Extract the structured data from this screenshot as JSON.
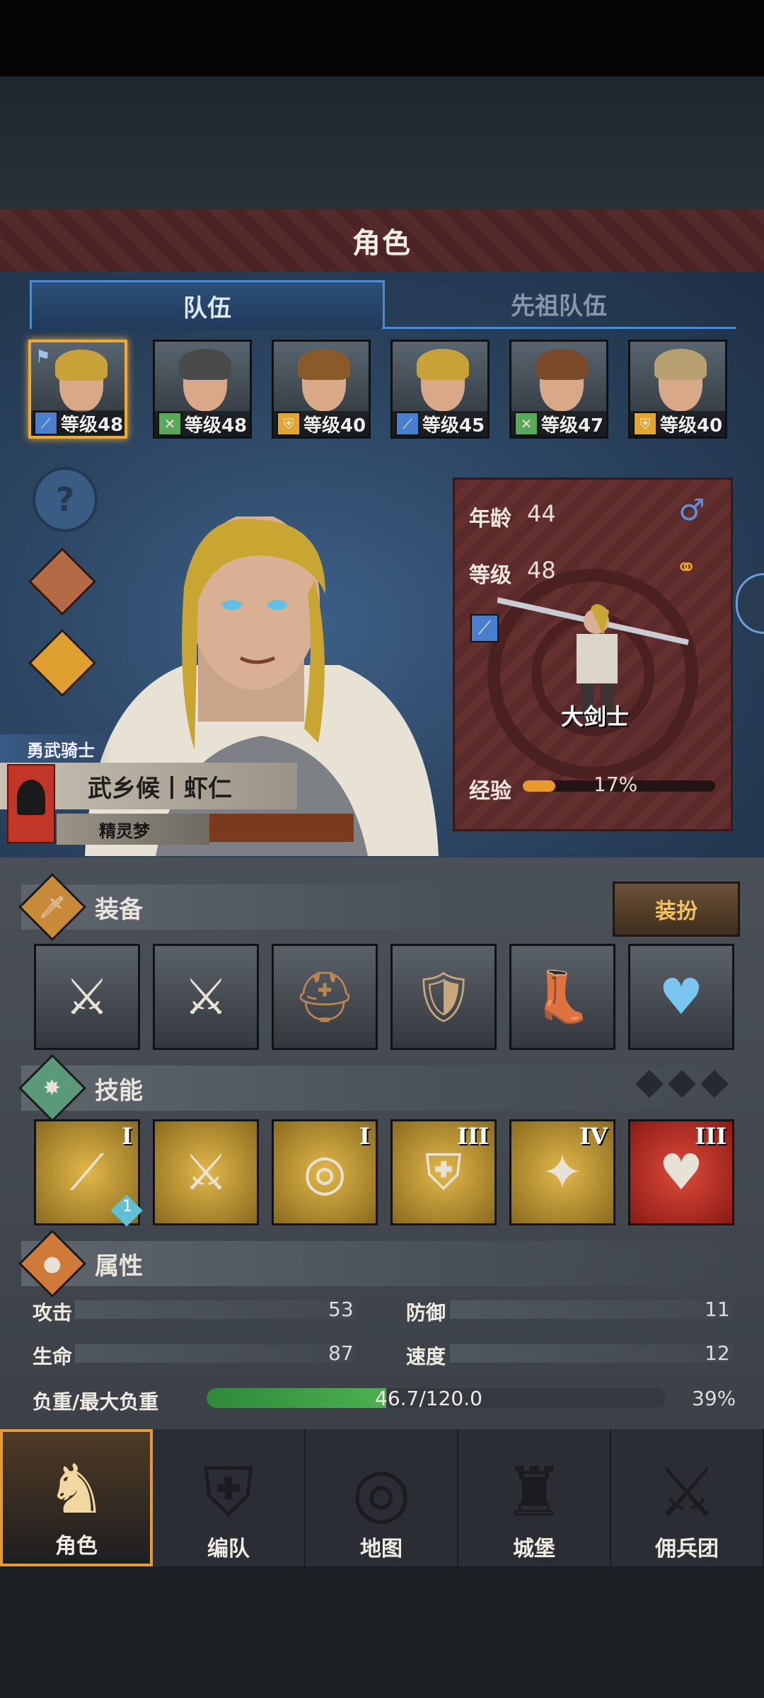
{
  "header": {
    "title": "角色"
  },
  "tabs": [
    {
      "label": "队伍",
      "active": true
    },
    {
      "label": "先祖队伍",
      "active": false
    }
  ],
  "party": [
    {
      "level": "等级48",
      "class_icon": "sword-icon",
      "class_color": "#4a7fd0",
      "hair": "#c8a238",
      "selected": true
    },
    {
      "level": "等级48",
      "class_icon": "crossed-swords-icon",
      "class_color": "#59a85a",
      "hair": "#4a4a4a",
      "selected": false
    },
    {
      "level": "等级40",
      "class_icon": "shield-icon",
      "class_color": "#e0a630",
      "hair": "#8a5a2a",
      "selected": false
    },
    {
      "level": "等级45",
      "class_icon": "sword-icon",
      "class_color": "#4a7fd0",
      "hair": "#c8a238",
      "selected": false
    },
    {
      "level": "等级47",
      "class_icon": "crossed-swords-icon",
      "class_color": "#59a85a",
      "hair": "#7a4a2a",
      "selected": false
    },
    {
      "level": "等级40",
      "class_icon": "shield-icon",
      "class_color": "#e0a630",
      "hair": "#b8a070",
      "selected": false
    }
  ],
  "side_icons": [
    "help-icon",
    "armor-figure-icon",
    "potion-bag-icon"
  ],
  "character": {
    "title": "勇武骑士",
    "name": "武乡候丨虾仁",
    "nickname": "精灵梦",
    "age_label": "年龄",
    "age": "44",
    "level_label": "等级",
    "level": "48",
    "class_name": "大剑士",
    "exp_label": "经验",
    "exp_percent": "17%",
    "exp_fraction": 0.17
  },
  "equipment": {
    "title": "装备",
    "outfit_button": "装扮",
    "slots": [
      "greatsword-icon",
      "greatsword-icon",
      "helmet-icon",
      "armor-icon",
      "boots-icon",
      "amulet-icon"
    ]
  },
  "skills": {
    "title": "技能",
    "items": [
      {
        "icon": "slash-skill-icon",
        "rank": "I",
        "bg": "#d4a93a"
      },
      {
        "icon": "sword-aura-skill-icon",
        "rank": "",
        "bg": "#d4a93a"
      },
      {
        "icon": "target-skill-icon",
        "rank": "I",
        "bg": "#d4a93a"
      },
      {
        "icon": "shield-skill-icon",
        "rank": "III",
        "bg": "#d4a93a"
      },
      {
        "icon": "shatter-skill-icon",
        "rank": "IV",
        "bg": "#d4a93a"
      },
      {
        "icon": "heartbeat-skill-icon",
        "rank": "III",
        "bg": "#c0302a"
      }
    ],
    "badge": "1"
  },
  "attributes": {
    "title": "属性",
    "attack_label": "攻击",
    "attack": "53",
    "defense_label": "防御",
    "defense": "11",
    "hp_label": "生命",
    "hp": "87",
    "speed_label": "速度",
    "speed": "12",
    "load_label": "负重/最大负重",
    "load": "46.7/120.0",
    "load_percent": "39%",
    "load_fraction": 0.39
  },
  "nav": [
    {
      "label": "角色",
      "icon": "knight-icon",
      "active": true
    },
    {
      "label": "编队",
      "icon": "formation-icon",
      "active": false
    },
    {
      "label": "地图",
      "icon": "compass-map-icon",
      "active": false
    },
    {
      "label": "城堡",
      "icon": "castle-icon",
      "active": false
    },
    {
      "label": "佣兵团",
      "icon": "mercenary-icon",
      "active": false
    }
  ],
  "colors": {
    "accent": "#f0a832",
    "tab_blue": "#4c8ad6",
    "panel_red": "#5a2a2a"
  }
}
